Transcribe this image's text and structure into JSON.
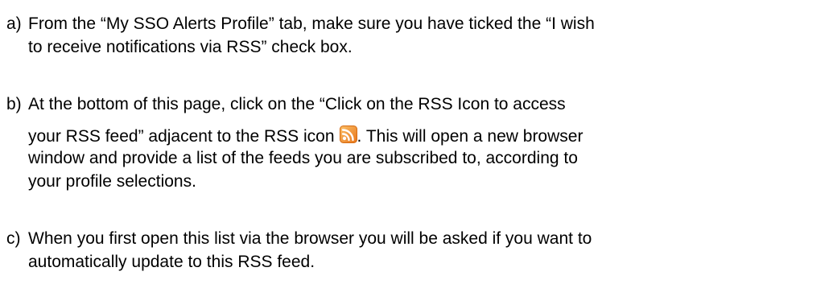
{
  "items": [
    {
      "marker": "a)",
      "lines": [
        "From the “My SSO Alerts Profile” tab, make sure you have ticked the “I wish",
        "to receive notifications via RSS” check box."
      ]
    },
    {
      "marker": "b)",
      "lines": [
        "At the bottom of this page, click on the “Click on the RSS Icon to access",
        "your RSS feed” adjacent to the RSS icon",
        ".  This will open a new browser",
        "window and provide a list of the feeds you are subscribed to, according to",
        "your profile selections."
      ],
      "inline_icon": "rss-icon"
    },
    {
      "marker": "c)",
      "lines": [
        "When you first open this list via the browser you will be asked if you want to",
        "automatically update to this RSS feed."
      ]
    }
  ],
  "colors": {
    "text": "#000000",
    "rss_orange": "#F7931E",
    "rss_orange_light": "#FBC068"
  }
}
